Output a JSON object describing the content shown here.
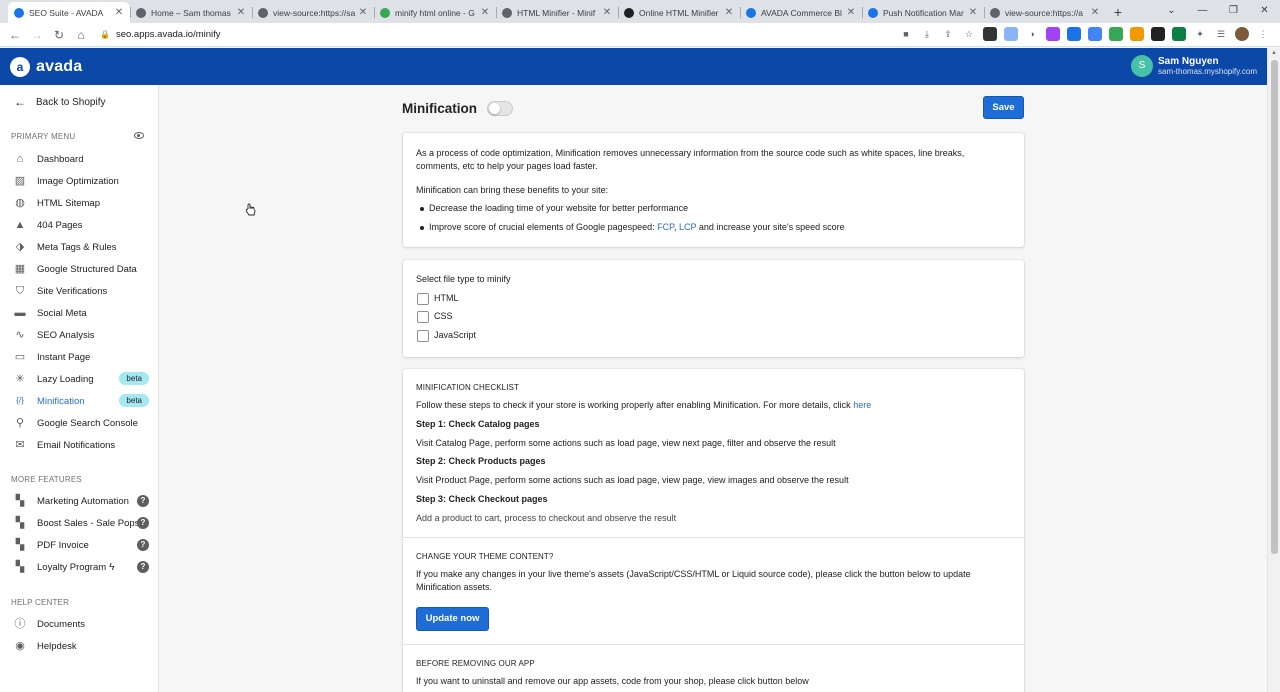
{
  "browser": {
    "tabs": [
      {
        "title": "SEO Suite - AVADA",
        "color": "#1a73e8",
        "active": true
      },
      {
        "title": "Home – Sam thomas",
        "color": "#5f6368",
        "active": false
      },
      {
        "title": "view-source:https://sa",
        "color": "#5f6368",
        "active": false
      },
      {
        "title": "minify html online - G",
        "color": "#34a853",
        "active": false
      },
      {
        "title": "HTML Minifier - Minif",
        "color": "#5f6368",
        "active": false
      },
      {
        "title": "Online HTML Minifier",
        "color": "#202124",
        "active": false
      },
      {
        "title": "AVADA Commerce Bl",
        "color": "#1a73e8",
        "active": false
      },
      {
        "title": "Push Notification Mar",
        "color": "#1a73e8",
        "active": false
      },
      {
        "title": "view-source:https://a",
        "color": "#5f6368",
        "active": false
      }
    ],
    "url": "seo.apps.avada.io/minify"
  },
  "header": {
    "brand": "avada",
    "user_name": "Sam Nguyen",
    "user_shop": "sam-thomas.myshopify.com",
    "avatar_letter": "S"
  },
  "sidebar": {
    "back_label": "Back to Shopify",
    "primary_title": "PRIMARY MENU",
    "primary": [
      {
        "label": "Dashboard",
        "icon": "home-icon"
      },
      {
        "label": "Image Optimization",
        "icon": "image-icon"
      },
      {
        "label": "HTML Sitemap",
        "icon": "globe-icon"
      },
      {
        "label": "404 Pages",
        "icon": "warning-icon"
      },
      {
        "label": "Meta Tags & Rules",
        "icon": "tag-icon"
      },
      {
        "label": "Google Structured Data",
        "icon": "structured-data-icon"
      },
      {
        "label": "Site Verifications",
        "icon": "shield-icon"
      },
      {
        "label": "Social Meta",
        "icon": "chat-icon"
      },
      {
        "label": "SEO Analysis",
        "icon": "pulse-icon"
      },
      {
        "label": "Instant Page",
        "icon": "page-icon"
      },
      {
        "label": "Lazy Loading",
        "icon": "spinner-icon",
        "badge": "beta"
      },
      {
        "label": "Minification",
        "icon": "code-icon",
        "badge": "beta",
        "active": true
      },
      {
        "label": "Google Search Console",
        "icon": "search-icon"
      },
      {
        "label": "Email Notifications",
        "icon": "email-icon"
      }
    ],
    "more_title": "MORE FEATURES",
    "more": [
      {
        "label": "Marketing Automation",
        "icon": "apps-icon"
      },
      {
        "label": "Boost Sales - Sale Pops",
        "icon": "apps-icon"
      },
      {
        "label": "PDF Invoice",
        "icon": "apps-icon"
      },
      {
        "label": "Loyalty Program",
        "icon": "apps-icon"
      }
    ],
    "help_title": "HELP CENTER",
    "help": [
      {
        "label": "Documents",
        "icon": "info-icon"
      },
      {
        "label": "Helpdesk",
        "icon": "help-icon"
      }
    ]
  },
  "main": {
    "title": "Minification",
    "save_label": "Save",
    "intro": "As a process of code optimization, Minification removes unnecessary information from the source code such as white spaces, line breaks, comments, etc to help your pages load faster.",
    "benefits_lead": "Minification can bring these benefits to your site:",
    "benefit_1": "Decrease the loading time of your website for better performance",
    "benefit_2_prefix": "Improve score of crucial elements of Google pagespeed: ",
    "benefit_2_fcp": "FCP",
    "benefit_2_sep": ", ",
    "benefit_2_lcp": "LCP",
    "benefit_2_suffix": " and increase your site's speed score",
    "file_type_label": "Select file type to minify",
    "file_types": [
      "HTML",
      "CSS",
      "JavaScript"
    ],
    "checklist_title": "MINIFICATION CHECKLIST",
    "checklist_intro": "Follow these steps to check if your store is working properly after enabling Minification. For more details, click ",
    "checklist_link": "here",
    "step1_title": "Step 1: Check Catalog pages",
    "step1_text": "Visit Catalog Page, perform some actions such as load page, view next page, filter and observe the result",
    "step2_title": "Step 2: Check Products pages",
    "step2_text": "Visit Product Page, perform some actions such as load page, view page, view images and observe the result",
    "step3_title": "Step 3: Check Checkout pages",
    "step3_text": "Add a product to cart, process to checkout and observe the result",
    "theme_title": "CHANGE YOUR THEME CONTENT?",
    "theme_text": "If you make any changes in your live theme's assets (JavaScript/CSS/HTML or Liquid source code), please click the button below to update Minification assets.",
    "update_label": "Update now",
    "remove_title": "BEFORE REMOVING OUR APP",
    "remove_text": "If you want to uninstall and remove our app assets, code from your shop, please click button below"
  }
}
